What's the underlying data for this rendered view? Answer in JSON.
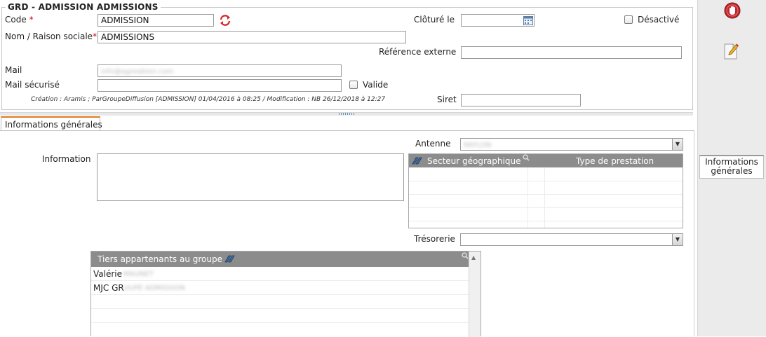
{
  "header": {
    "legend": "GRD - ADMISSION ADMISSIONS",
    "code_label": "Code",
    "code_value": "ADMISSION",
    "name_label": "Nom / Raison sociale",
    "name_value": "ADMISSIONS",
    "required_mark": "*",
    "cloture_label": "Clôturé le",
    "cloture_value": "",
    "desactive_label": "Désactivé",
    "ref_label": "Référence externe",
    "ref_value": "",
    "mail_label": "Mail",
    "mail_value": "info@agreabion.com",
    "mail_secure_label": "Mail sécurisé",
    "mail_secure_value": "",
    "valide_label": "Valide",
    "meta": "Création : Aramis ; ParGroupeDiffusion [ADMISSION] 01/04/2016 à 08:25 / Modification : NB 26/12/2018 à 12:27",
    "siret_label": "Siret",
    "siret_value": ""
  },
  "tabs": [
    {
      "label": "Informations générales"
    }
  ],
  "general": {
    "antenne_label": "Antenne",
    "antenne_value": "RAYLON",
    "information_label": "Information",
    "information_value": "",
    "secteur_grid": {
      "columns": [
        "Secteur géographique",
        "Type de prestation"
      ]
    },
    "tresorerie_label": "Trésorerie",
    "tresorerie_value": "",
    "tiers_grid": {
      "title": "Tiers appartenants au groupe",
      "rows": [
        {
          "first": "Valérie",
          "rest": "MAUNET"
        },
        {
          "first": "MJC GR",
          "rest": "OUPE ADMISSION"
        }
      ]
    }
  },
  "sidebar": {
    "tab_label": "Informations générales"
  },
  "colors": {
    "accent_tab": "#e07b1f",
    "grid_header": "#8c8c8c",
    "required": "#d0021b",
    "stop_button": "#c0282d"
  }
}
